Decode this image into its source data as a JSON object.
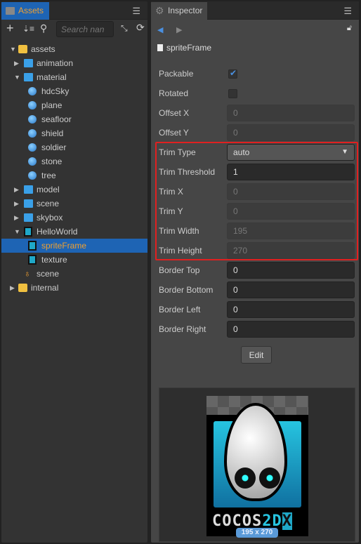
{
  "assets_panel": {
    "tab": "Assets",
    "search_placeholder": "Search nan",
    "tree": [
      {
        "label": "assets",
        "level": 0,
        "icon": "database-icon",
        "expanded": true
      },
      {
        "label": "animation",
        "level": 1,
        "icon": "folder-icon",
        "expanded": false
      },
      {
        "label": "material",
        "level": 1,
        "icon": "folder-icon",
        "expanded": true
      },
      {
        "label": "hdcSky",
        "level": 2,
        "icon": "material-icon"
      },
      {
        "label": "plane",
        "level": 2,
        "icon": "material-icon"
      },
      {
        "label": "seafloor",
        "level": 2,
        "icon": "material-icon"
      },
      {
        "label": "shield",
        "level": 2,
        "icon": "material-icon"
      },
      {
        "label": "soldier",
        "level": 2,
        "icon": "material-icon"
      },
      {
        "label": "stone",
        "level": 2,
        "icon": "material-icon"
      },
      {
        "label": "tree",
        "level": 2,
        "icon": "material-icon"
      },
      {
        "label": "model",
        "level": 1,
        "icon": "folder-icon",
        "expanded": false
      },
      {
        "label": "scene",
        "level": 1,
        "icon": "folder-icon",
        "expanded": false
      },
      {
        "label": "skybox",
        "level": 1,
        "icon": "folder-icon",
        "expanded": false
      },
      {
        "label": "HelloWorld",
        "level": 1,
        "icon": "image-icon",
        "expanded": true
      },
      {
        "label": "spriteFrame",
        "level": 2,
        "icon": "sprite-icon",
        "selected": true
      },
      {
        "label": "texture",
        "level": 2,
        "icon": "sprite-icon"
      },
      {
        "label": "scene",
        "level": 1,
        "icon": "scene-icon"
      },
      {
        "label": "internal",
        "level": 0,
        "icon": "database-icon",
        "expanded": false
      }
    ]
  },
  "inspector": {
    "tab": "Inspector",
    "asset_name": "spriteFrame",
    "props": [
      {
        "label": "Packable",
        "type": "checkbox",
        "checked": true
      },
      {
        "label": "Rotated",
        "type": "checkbox",
        "checked": false
      },
      {
        "label": "Offset X",
        "value": "0"
      },
      {
        "label": "Offset Y",
        "value": "0"
      },
      {
        "label": "Trim Type",
        "type": "select",
        "value": "auto"
      },
      {
        "label": "Trim Threshold",
        "value": "1",
        "editable": true
      },
      {
        "label": "Trim X",
        "value": "0"
      },
      {
        "label": "Trim Y",
        "value": "0"
      },
      {
        "label": "Trim Width",
        "value": "195"
      },
      {
        "label": "Trim Height",
        "value": "270"
      },
      {
        "label": "Border Top",
        "value": "0",
        "editable": true
      },
      {
        "label": "Border Bottom",
        "value": "0",
        "editable": true
      },
      {
        "label": "Border Left",
        "value": "0",
        "editable": true
      },
      {
        "label": "Border Right",
        "value": "0",
        "editable": true
      }
    ],
    "edit_label": "Edit",
    "preview_size": "195 x 270",
    "logo_text": "COCOS2DX",
    "highlight_color": "#e02020"
  }
}
